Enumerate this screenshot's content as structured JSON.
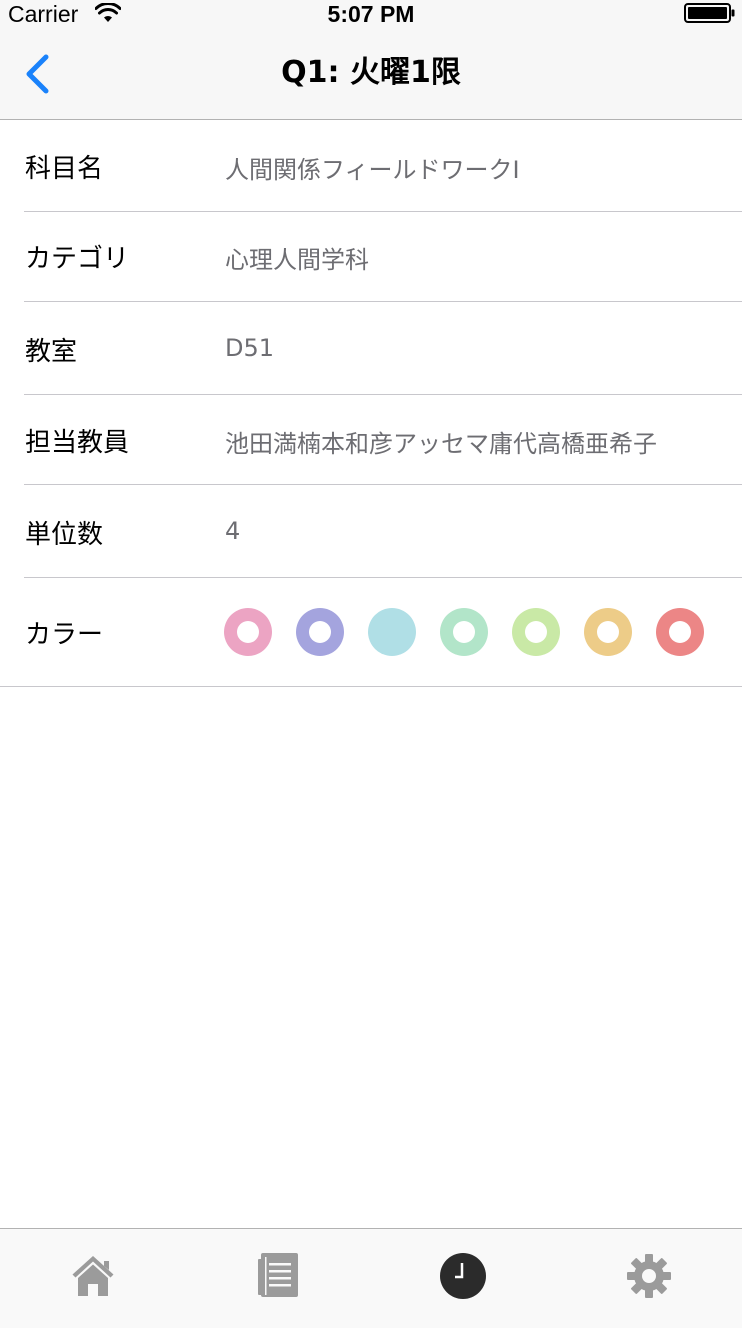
{
  "status_bar": {
    "carrier": "Carrier",
    "time": "5:07 PM",
    "wifi_icon": "wifi-icon",
    "battery_icon": "battery-full-icon"
  },
  "nav": {
    "title": "Q1: 火曜1限",
    "back_icon": "chevron-left-icon",
    "tint_color": "#1a82fb"
  },
  "rows": [
    {
      "label": "科目名",
      "value": "人間関係フィールドワークI"
    },
    {
      "label": "カテゴリ",
      "value": "心理人間学科"
    },
    {
      "label": "教室",
      "value": "D51"
    },
    {
      "label": "担当教員",
      "value": "池田満楠本和彦アッセマ庸代高橋亜希子"
    },
    {
      "label": "単位数",
      "value": "4"
    }
  ],
  "color_row": {
    "label": "カラー",
    "swatches": [
      {
        "color": "#eca4c3",
        "selected": false
      },
      {
        "color": "#a4a4de",
        "selected": false
      },
      {
        "color": "#b0dfe6",
        "selected": true
      },
      {
        "color": "#b2e5c9",
        "selected": false
      },
      {
        "color": "#c9e9a6",
        "selected": false
      },
      {
        "color": "#edcc88",
        "selected": false
      },
      {
        "color": "#ec8686",
        "selected": false
      }
    ]
  },
  "tab_bar": {
    "items": [
      {
        "icon": "home-icon",
        "active": false
      },
      {
        "icon": "notes-icon",
        "active": false
      },
      {
        "icon": "clock-icon",
        "active": true
      },
      {
        "icon": "gear-icon",
        "active": false
      }
    ],
    "inactive_color": "#9b9b9b",
    "active_color": "#2b2b2b"
  }
}
